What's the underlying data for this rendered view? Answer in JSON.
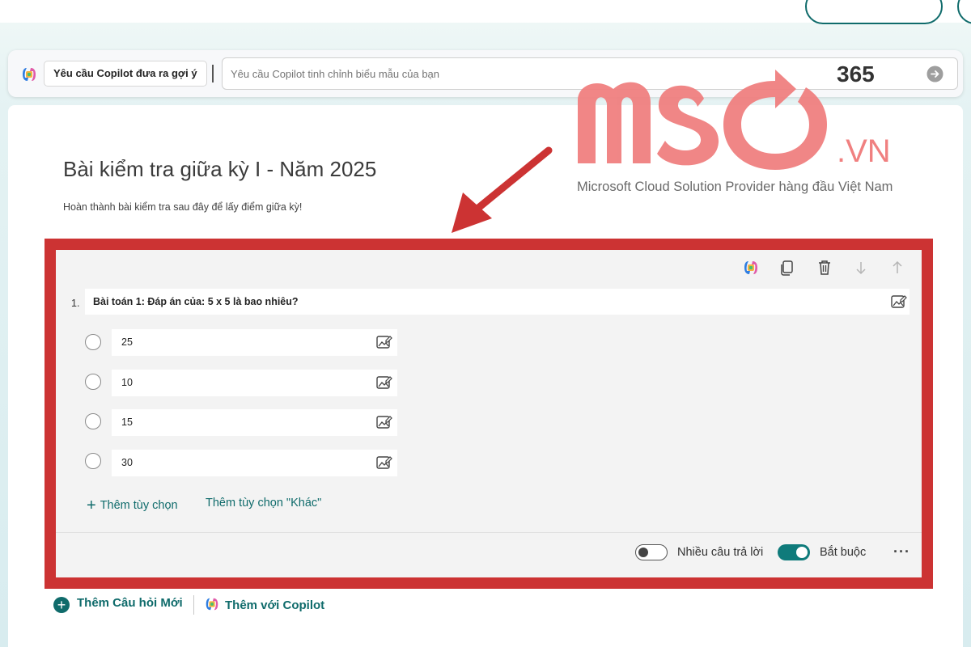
{
  "copilot_bar": {
    "suggest_button_label": "Yêu cầu Copilot đưa ra gợi ý",
    "refine_input_placeholder": "Yêu cầu Copilot tinh chỉnh biểu mẫu của bạn"
  },
  "watermark": {
    "product": "365",
    "brand": "MSO.VN",
    "tagline": "Microsoft Cloud Solution Provider hàng đầu Việt Nam"
  },
  "form": {
    "title": "Bài kiểm tra giữa kỳ I - Năm 2025",
    "description": "Hoàn thành bài kiểm tra sau đây để lấy điểm giữa kỳ!"
  },
  "question": {
    "number": "1.",
    "text": "Bài toán 1: Đáp án của: 5 x 5 là bao nhiêu?",
    "options": [
      "25",
      "10",
      "15",
      "30"
    ],
    "add_option_label": "Thêm tùy chọn",
    "add_other_label": "Thêm tùy chọn \"Khác\"",
    "multiple_answers_label": "Nhiều câu trả lời",
    "multiple_answers_on": false,
    "required_label": "Bắt buộc",
    "required_on": true,
    "more_label": "···"
  },
  "bottom_actions": {
    "add_question_label": "Thêm Câu hỏi Mới",
    "add_with_copilot_label": "Thêm với Copilot"
  },
  "colors": {
    "accent": "#0f6b6b",
    "highlight_frame": "#cc3333",
    "watermark": "#f08080"
  },
  "icons": [
    "copilot-icon",
    "send-arrow-icon",
    "copy-icon",
    "trash-icon",
    "arrow-down-icon",
    "arrow-up-icon",
    "insert-image-icon",
    "plus-icon",
    "more-icon"
  ]
}
